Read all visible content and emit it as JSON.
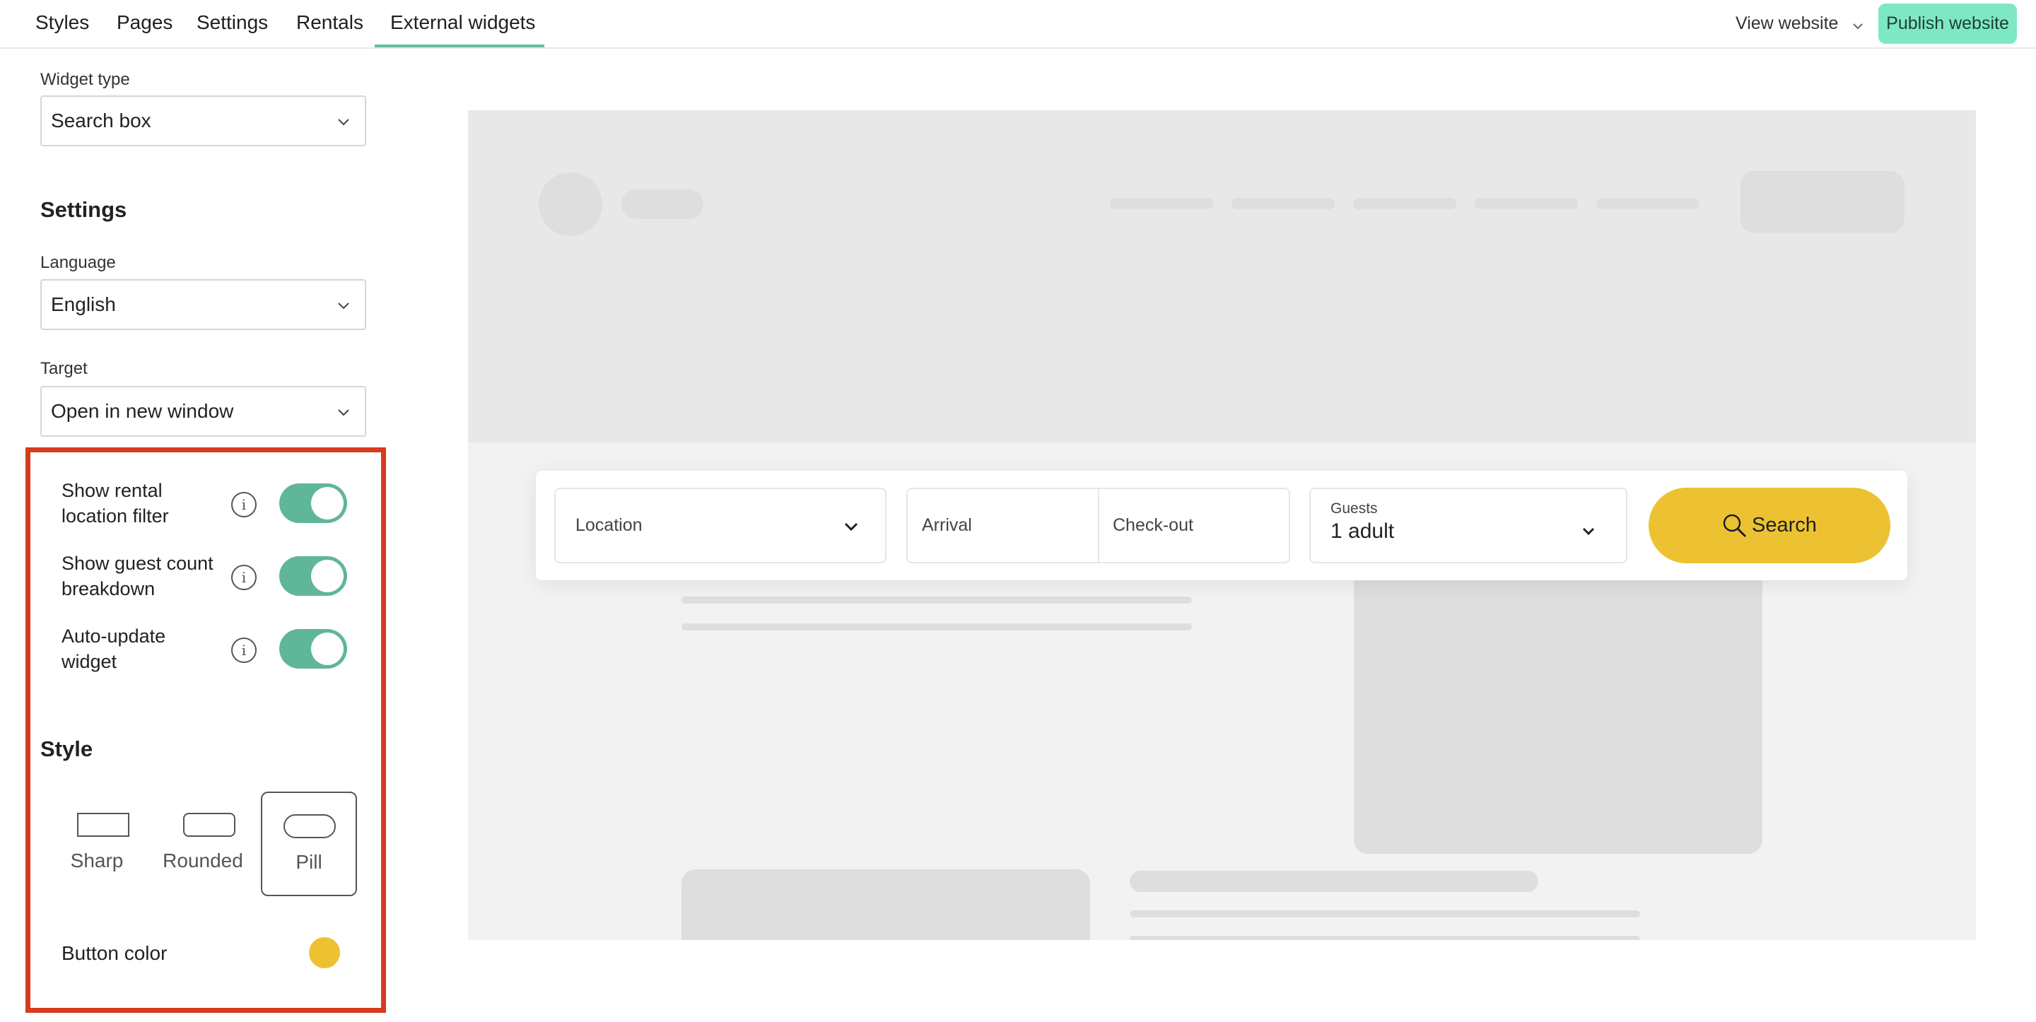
{
  "nav": {
    "tabs": [
      {
        "label": "Styles"
      },
      {
        "label": "Pages"
      },
      {
        "label": "Settings"
      },
      {
        "label": "Rentals"
      },
      {
        "label": "External widgets",
        "active": true
      }
    ],
    "view_website": "View website",
    "publish_label": "Publish website"
  },
  "panel": {
    "widget_type": {
      "label": "Widget type",
      "value": "Search box"
    },
    "settings_title": "Settings",
    "language": {
      "label": "Language",
      "value": "English"
    },
    "target": {
      "label": "Target",
      "value": "Open in new window"
    },
    "toggles": [
      {
        "label": "Show rental location filter",
        "on": true
      },
      {
        "label": "Show guest count breakdown",
        "on": true
      },
      {
        "label": "Auto-update widget",
        "on": true
      }
    ],
    "info_glyph": "i",
    "style_title": "Style",
    "styles": [
      {
        "label": "Sharp",
        "selected": false
      },
      {
        "label": "Rounded",
        "selected": false
      },
      {
        "label": "Pill",
        "selected": true
      }
    ],
    "button_color": {
      "label": "Button color",
      "value": "#ecc232"
    }
  },
  "preview": {
    "location_placeholder": "Location",
    "arrival_placeholder": "Arrival",
    "checkout_placeholder": "Check-out",
    "guests_label": "Guests",
    "guests_value": "1 adult",
    "search_label": "Search"
  },
  "colors": {
    "accent": "#5fbf9c",
    "publish": "#7ee8c3",
    "toggle_on": "#5fb698",
    "highlight": "#d63b1e",
    "search_button": "#ecc232"
  }
}
